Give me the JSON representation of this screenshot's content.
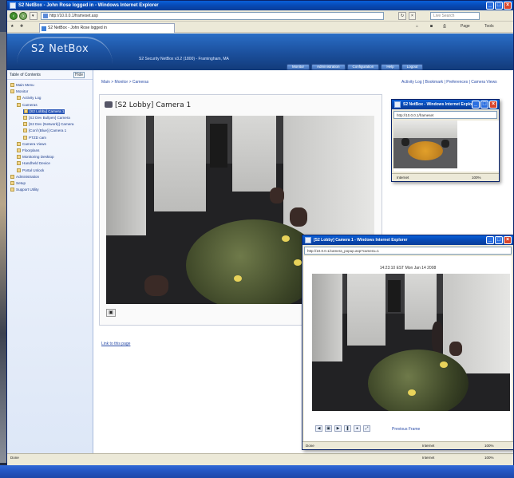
{
  "main_window": {
    "title": "S2 NetBox - John Rose logged in - Windows Internet Explorer",
    "address": "http://10.0.0.1/frameset.asp",
    "tab_label": "S2 NetBox - John Rose logged in",
    "search_placeholder": "Live Search",
    "commands": [
      "Page",
      "Tools"
    ]
  },
  "banner": {
    "logo": "S2 NetBox",
    "subtitle": "S2 Security NetBox v3.2 (1800) - Framingham, MA",
    "menu": [
      "Monitor",
      "Administration",
      "Configuration",
      "Help",
      "Logout"
    ]
  },
  "sidebar": {
    "header": "Table of Contents",
    "header_button": "Hide",
    "items": [
      {
        "label": "Main Menu",
        "indent": 0
      },
      {
        "label": "Monitor",
        "indent": 0
      },
      {
        "label": "Activity Log",
        "indent": 1
      },
      {
        "label": "Cameras",
        "indent": 1
      },
      {
        "label": "[S2 Lobby] Camera 1",
        "indent": 2,
        "selected": true
      },
      {
        "label": "[S2 Dev Bullpen] Camera",
        "indent": 2
      },
      {
        "label": "[S2 Dev (Network)] Camera",
        "indent": 2
      },
      {
        "label": "[Conf (Blue)] Camera 1",
        "indent": 2
      },
      {
        "label": "PTZD cam",
        "indent": 2
      },
      {
        "label": "Camera Views",
        "indent": 1
      },
      {
        "label": "Floorplans",
        "indent": 1
      },
      {
        "label": "Monitoring Desktop",
        "indent": 1
      },
      {
        "label": "Handheld Device",
        "indent": 1
      },
      {
        "label": "Portal Unlock",
        "indent": 1
      },
      {
        "label": "Administration",
        "indent": 0
      },
      {
        "label": "Setup",
        "indent": 0
      },
      {
        "label": "Support Utility",
        "indent": 0
      }
    ]
  },
  "breadcrumb": "Main > Monitor > Cameras",
  "topright_links": "Activity Log | Bookmark | Preferences | Camera Views",
  "camera": {
    "title": "[S2 Lobby] Camera 1",
    "static_link": "Link to this page"
  },
  "mini_popup": {
    "title": "S2 NetBox - Windows Internet Explorer",
    "address": "http://10.0.0.1/frameset",
    "status_left": "Internet",
    "status_right": "100%"
  },
  "large_popup": {
    "title": "[S2 Lobby] Camera 1 - Windows Internet Explorer",
    "address": "http://10.0.0.1/camera_popup.asp?camera=1",
    "timestamp": "14:23:10 EST Mon Jan 14 2008",
    "prev_frame": "Previous Frame",
    "status_left": "Done",
    "status_mid": "Internet",
    "status_right": "100%"
  },
  "main_status": {
    "left": "Done",
    "mid": "Internet",
    "right": "100%"
  }
}
